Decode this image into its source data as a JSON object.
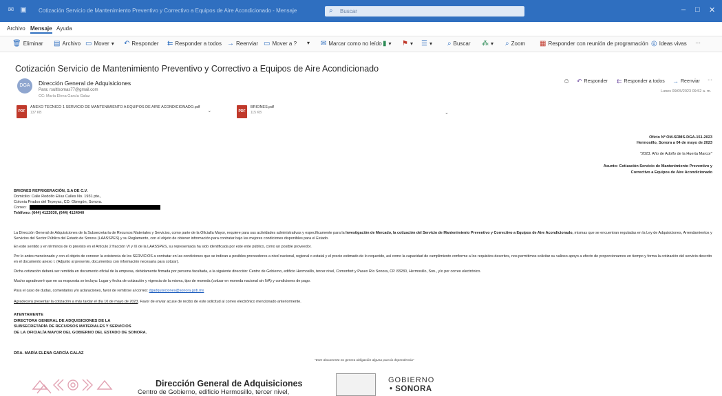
{
  "window": {
    "title": "Cotización Servicio de Mantenimiento Preventivo y Correctivo a Equipos de Aire Acondicionado - Mensaje",
    "search_placeholder": "Buscar"
  },
  "menu": [
    "Archivo",
    "Mensaje",
    "Ayuda"
  ],
  "ribbon": [
    {
      "label": "Eliminar",
      "icon": "trash-icon"
    },
    {
      "label": "Archivo",
      "icon": "archive-icon"
    },
    {
      "label": "Mover",
      "icon": "move-icon"
    },
    {
      "label": "Responder",
      "icon": "reply-icon"
    },
    {
      "label": "Responder a todos",
      "icon": "reply-all-icon"
    },
    {
      "label": "Reenviar",
      "icon": "forward-icon"
    },
    {
      "label": "Mover a ?",
      "icon": "move-to-icon"
    },
    {
      "label": "Marcar como no leído",
      "icon": "mark-unread-icon"
    },
    {
      "label": "Buscar",
      "icon": "search-icon"
    },
    {
      "label": "Zoom",
      "icon": "zoom-icon"
    },
    {
      "label": "Responder con reunión de programación",
      "icon": "calendar-reply-icon"
    },
    {
      "label": "Ideas vivas",
      "icon": "ideas-icon"
    },
    {
      "label": "···",
      "icon": "more-icon"
    }
  ],
  "message": {
    "subject": "Cotización Servicio de Mantenimiento Preventivo y Correctivo a Equipos de Aire Acondicionado",
    "avatar_initials": "DGA",
    "sender_name": "Dirección General de Adquisiciones",
    "sender_email": "Para: rsultlsomas77@gmail.com",
    "cc": "CC: María Elena García Galaz",
    "date": "Lunes 09/05/2023 09:52 a. m.",
    "actions": [
      "Responder",
      "Responder a todos",
      "Reenviar",
      "···"
    ]
  },
  "attachments": [
    {
      "name": "ANEXO TECNICO 1 SERVICIO DE MANTENIMIENTO A EQUIPOS DE AIRE ACONDICIONADO.pdf",
      "size": "137 KB"
    },
    {
      "name": "BRIONES.pdf",
      "size": "115 KB"
    }
  ],
  "letter": {
    "oficio": "Oficio Nº OM-SRMS-DGA-151-2023",
    "lugar_fecha": "Hermosillo, Sonora a 04 de mayo de 2023",
    "lema": "\"2023. Año de Adolfo de la Huerta Marcor\"",
    "asunto_1": "Asunto: Cotización Servicio de Mantenimiento Preventivo y",
    "asunto_2": "Correctivo a Equipos de Aire Acondicionado",
    "addr": {
      "company": "BRIONES REFRIGERACIÓN, S.A DE C.V.",
      "domicilio": "Domicilio: Calle Rodolfo Elías Calles No. 1931 pte.,",
      "colonia": "Colonia Prados del Tepeyac, CD. Obregón, Sonora.",
      "correo": "Correo:",
      "telefono": "Teléfono: (644) 4122030, (644) 4124040"
    },
    "p1_pre": "La Dirección General de Adquisiciones de la Subsecretaría de Recursos Materiales y Servicios, como parte de la Oficialía Mayor, requiere para sus actividades administrativas y específicamente para la ",
    "p1_bold": "Investigación de Mercado, la cotización del Servicio de Mantenimiento Preventivo y Correctivo a Equipos de Aire Acondicionado,",
    "p1_post": " mismas que se encuentran reguladas en la Ley de Adquisiciones, Arrendamientos y Servicios del Sector Público del Estado de Sonora (LAASSPES) y su Reglamento, con el objeto de obtener información para contratar bajo las mejores condiciones disponibles para el Estado.",
    "p2": "En este sentido y en términos de lo previsto en el Artículo 2 fracción VI y IX de la LAASSPES, su representada ha sido identificada por este ente público, como un posible proveedor.",
    "p3": "Por lo antes mencionado y con el objeto de conocer la existencia de los SERVICIOS a contratar en las condiciones que se indican a posibles proveedores a nivel nacional, regional o estatal y el precio estimado de lo requerido, así como la capacidad de cumplimiento conforme a los requisitos descritos, nos permitimos solicitar su valioso apoyo a efecto de proporcionarnos en tiempo y forma la cotización del servicio descrito en el documento anexo I. (Adjunto al presente, documentos con información necesaria para cotizar).",
    "p4": "Dicha cotización deberá ser remitida en documento oficial de la empresa, debidamente firmada por persona facultada, a la siguiente dirección: Centro de Gobierno, edificio Hermosillo, tercer nivel, Comonfort y Paseo Río Sonora, CP. 83280, Hermosillo, Son., y/o por correo electrónico.",
    "p5": "Mucho agradeceré que en su respuesta se incluya: Lugar y fecha de cotización y vigencia de la misma, tipo de moneda (cotizar en moneda nacional sin IVA) y condiciones de pago.",
    "p6_pre": "Para el caso de dudas, comentarios y/o aclaraciones, favor de remitirse al correo: ",
    "p6_link": "dgadquisiciones@sonora.gob.mx",
    "p7_u": "Agradecerá presentar la cotización a más tardar el día 10 de mayo de 2023",
    "p7_post": ". Favor de enviar acuse de recibo de este solicitud al correo electrónico mencionado anteriormente.",
    "atentamente": "ATENTAMENTE",
    "sign_1": "DIRECTORA GENERAL DE ADQUISICIONES DE LA",
    "sign_2": "SUBSECRETARÍA DE RECURSOS MATERIALES Y SERVICIOS",
    "sign_3": "DE LA OFICIALÍA MAYOR DEL GOBIERNO DEL ESTADO DE SONORA.",
    "signer": "DRA. MARÍA ELENA GARCÍA GALAZ",
    "footnote": "\"Este documento no genera obligación alguna para la dependencia\""
  },
  "footer": {
    "title": "Dirección General de Adquisiciones",
    "subtitle": "Centro de Gobierno, edificio Hermosillo, tercer nivel,",
    "gob_1": "GOBIERNO",
    "gob_2": "SONORA"
  },
  "colors": {
    "titlebar": "#2f6fc0",
    "accent": "#2f6fc0",
    "pdf": "#c0392b"
  }
}
